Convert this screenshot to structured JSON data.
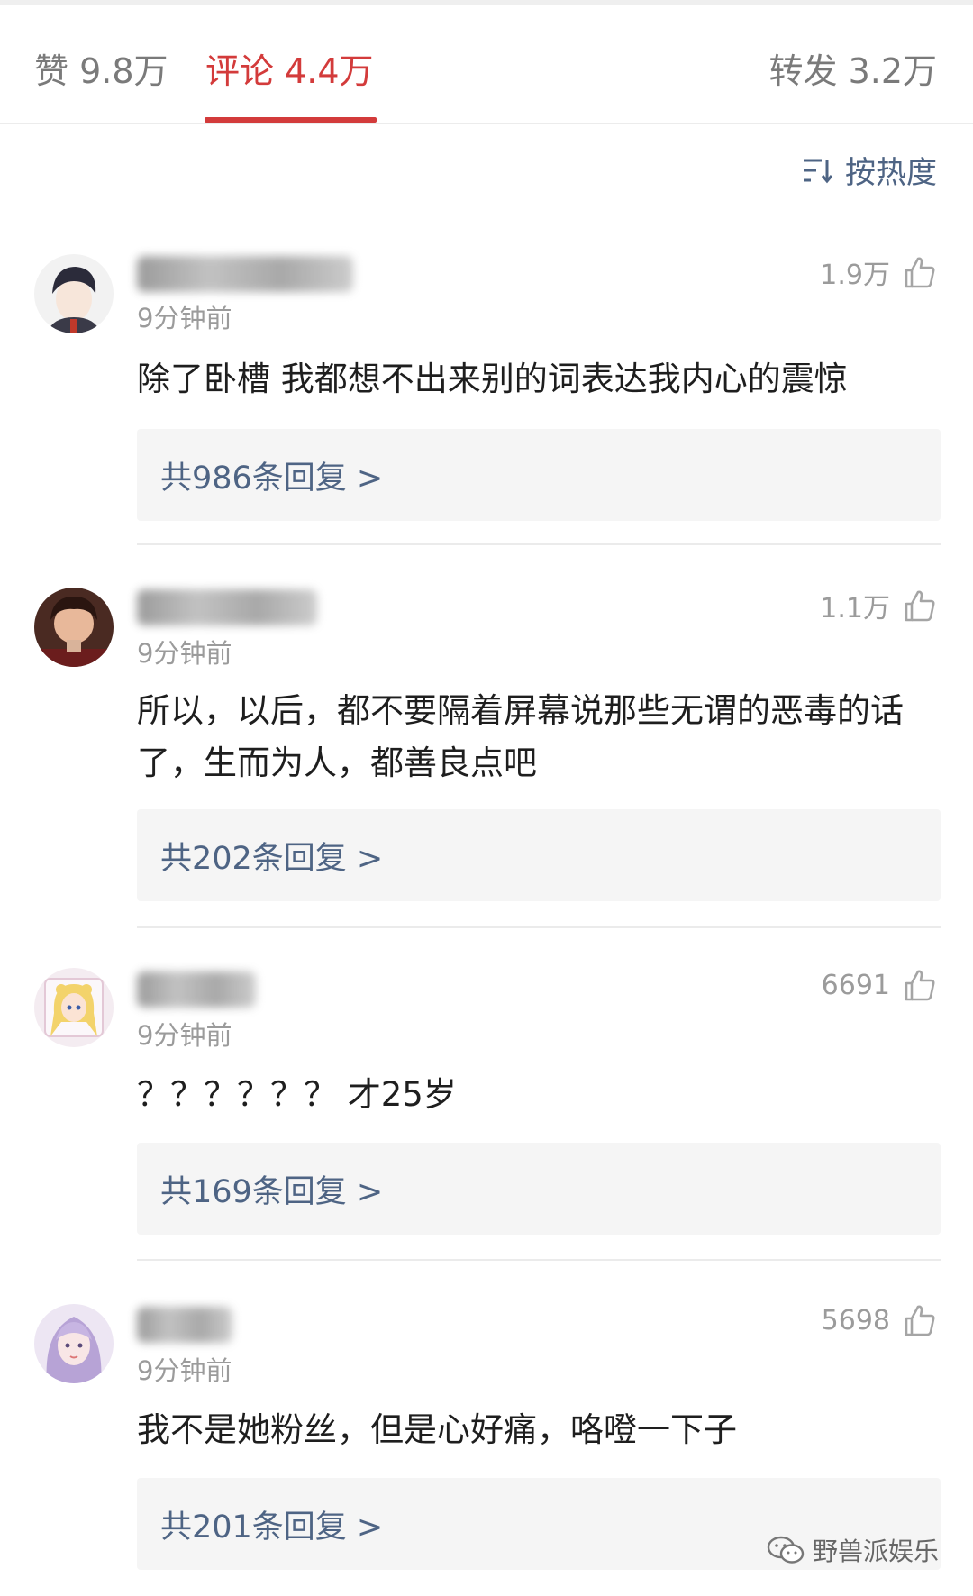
{
  "tabs": {
    "like": "赞 9.8万",
    "comment": "评论 4.4万",
    "repost": "转发 3.2万"
  },
  "sort": {
    "label": "按热度",
    "icon": "sort-icon"
  },
  "comments": [
    {
      "time": "9分钟前",
      "likes": "1.9万",
      "text": "除了卧槽 我都想不出来别的词表达我内心的震惊",
      "replies": "共986条回复 >"
    },
    {
      "time": "9分钟前",
      "likes": "1.1万",
      "text": "所以，以后，都不要隔着屏幕说那些无谓的恶毒的话了，生而为人，都善良点吧",
      "replies": "共202条回复 >"
    },
    {
      "time": "9分钟前",
      "likes": "6691",
      "text": "？？？？？？ 才25岁",
      "replies": "共169条回复 >"
    },
    {
      "time": "9分钟前",
      "likes": "5698",
      "text": "我不是她粉丝，但是心好痛，咯噔一下子",
      "replies": "共201条回复 >"
    }
  ],
  "watermark": {
    "text": "野兽派娱乐",
    "icon": "wechat-icon"
  },
  "colors": {
    "accent": "#d33b3b",
    "link": "#4e6484",
    "muted": "#9b9b9b"
  }
}
